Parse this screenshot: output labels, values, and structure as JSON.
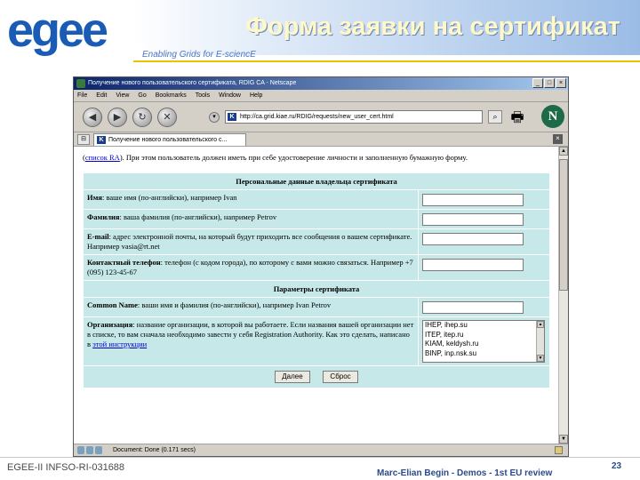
{
  "slide": {
    "logo": "egee",
    "title": "Форма заявки на сертификат",
    "tagline": "Enabling Grids for E-sciencE",
    "footer_left": "EGEE-II INFSO-RI-031688",
    "footer_right": "Marc-Elian Begin - Demos - 1st EU review",
    "page_number": "23"
  },
  "browser": {
    "title": "Получение нового пользовательского сертификата, RDIG CA - Netscape",
    "menu": [
      "File",
      "Edit",
      "View",
      "Go",
      "Bookmarks",
      "Tools",
      "Window",
      "Help"
    ],
    "url": "http://ca.grid.kiae.ru/RDIG/requests/new_user_cert.html",
    "tab_label": "Получение нового пользовательского с...",
    "status": "Document: Done (0.171 secs)",
    "site_icon": "K",
    "netscape_logo": "N"
  },
  "page": {
    "intro_link": "список RA",
    "intro_before": "(",
    "intro_after": "). При этом пользователь должен иметь при себе удостоверение личности и заполненную бумажную форму.",
    "section1_title": "Персональные данные владельца сертификата",
    "fields": [
      {
        "label": "Имя",
        "desc": ": ваше имя (по-английски), например Ivan"
      },
      {
        "label": "Фамилия",
        "desc": ": ваша фамилия (по-английски), например Petrov"
      },
      {
        "label": "E-mail",
        "desc": ": адрес электронной почты, на который будут приходить все сообщения о вашем сертификате. Например vasia@rt.net"
      },
      {
        "label": "Контактный телефон",
        "desc": ": телефон (с кодом города), по которому с вами можно связаться. Например +7 (095) 123-45-67"
      }
    ],
    "section2_title": "Параметры сертификата",
    "common_name": {
      "label": "Common Name",
      "desc": ": ваши имя и фамилия (по-английски), например Ivan Petrov"
    },
    "organization": {
      "label": "Организация",
      "desc": ": название организации, в которой вы работаете. Если названия вашей организации нет в списке, то вам сначала необходимо завести у себя Registration Authority. Как это сделать, написано в ",
      "link": "этой инструкции",
      "options": [
        "IHEP, ihep.su",
        "ITEP, itep.ru",
        "KIAM, keldysh.ru",
        "BINP, inp.nsk.su"
      ]
    },
    "submit_label": "Далее",
    "reset_label": "Сброс"
  }
}
